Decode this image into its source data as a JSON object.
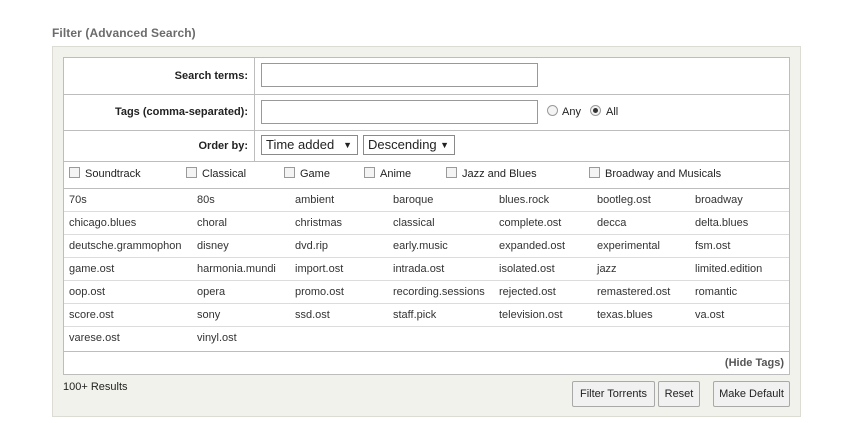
{
  "title": "Filter (Advanced Search)",
  "search_terms": {
    "label": "Search terms:",
    "value": ""
  },
  "tags_field": {
    "label": "Tags (comma-separated):",
    "value": "",
    "mode_any": "Any",
    "mode_all": "All",
    "selected_mode": "All"
  },
  "order": {
    "label": "Order by:",
    "field": "Time added",
    "direction": "Descending"
  },
  "categories": [
    "Soundtrack",
    "Classical",
    "Game",
    "Anime",
    "Jazz and Blues",
    "Broadway and Musicals"
  ],
  "tags": [
    [
      "70s",
      "80s",
      "ambient",
      "baroque",
      "blues.rock",
      "bootleg.ost",
      "broadway"
    ],
    [
      "chicago.blues",
      "choral",
      "christmas",
      "classical",
      "complete.ost",
      "decca",
      "delta.blues"
    ],
    [
      "deutsche.grammophon",
      "disney",
      "dvd.rip",
      "early.music",
      "expanded.ost",
      "experimental",
      "fsm.ost"
    ],
    [
      "game.ost",
      "harmonia.mundi",
      "import.ost",
      "intrada.ost",
      "isolated.ost",
      "jazz",
      "limited.edition"
    ],
    [
      "oop.ost",
      "opera",
      "promo.ost",
      "recording.sessions",
      "rejected.ost",
      "remastered.ost",
      "romantic"
    ],
    [
      "score.ost",
      "sony",
      "ssd.ost",
      "staff.pick",
      "television.ost",
      "texas.blues",
      "va.ost"
    ],
    [
      "varese.ost",
      "vinyl.ost"
    ]
  ],
  "hide_tags": "(Hide Tags)",
  "results": "100+ Results",
  "buttons": {
    "filter": "Filter Torrents",
    "reset": "Reset",
    "default": "Make Default"
  }
}
